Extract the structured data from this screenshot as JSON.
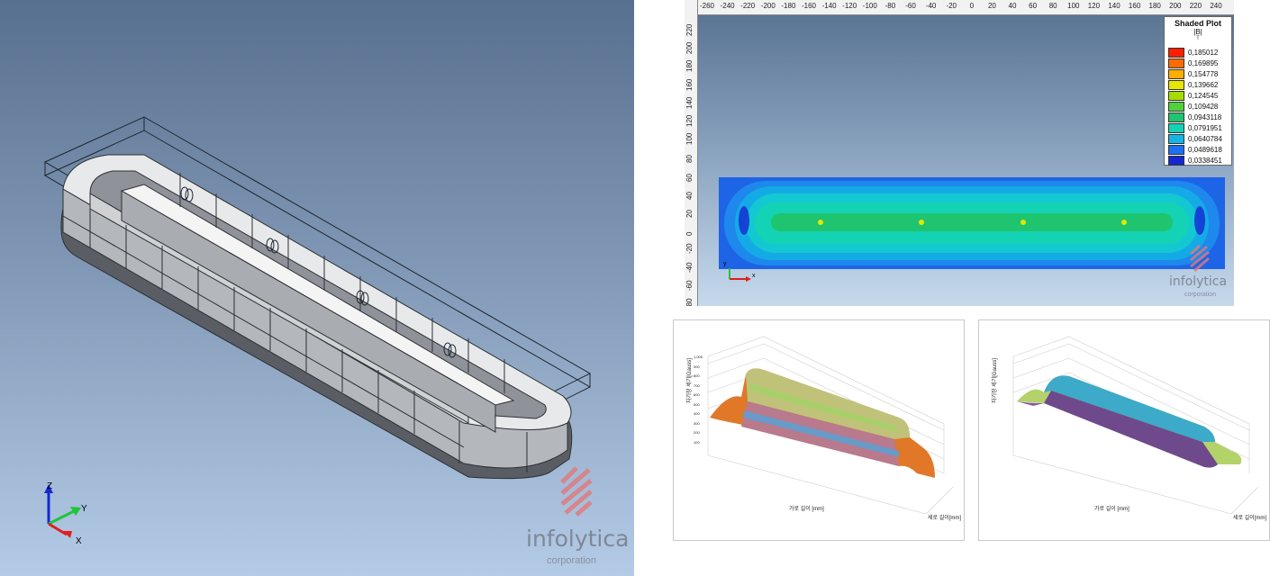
{
  "model_view": {
    "axis_labels": {
      "z": "Z",
      "y": "Y",
      "x": "X"
    },
    "logo": {
      "brand": "infolytica",
      "sub": "corporation"
    }
  },
  "plot_view": {
    "ruler_x": [
      "-260",
      "-240",
      "-220",
      "-200",
      "-180",
      "-160",
      "-140",
      "-120",
      "-100",
      "-80",
      "-60",
      "-40",
      "-20",
      "0",
      "20",
      "40",
      "60",
      "80",
      "100",
      "120",
      "140",
      "160",
      "180",
      "200",
      "220",
      "240",
      "2"
    ],
    "ruler_y": [
      "220",
      "200",
      "180",
      "160",
      "140",
      "120",
      "100",
      "80",
      "60",
      "40",
      "20",
      "0",
      "-20",
      "-40",
      "-60",
      "-80"
    ],
    "legend": {
      "title": "Shaded Plot",
      "quantity": "|B|",
      "unit": "T",
      "entries": [
        {
          "value": "0,185012",
          "color": "#ff1e00"
        },
        {
          "value": "0,169895",
          "color": "#ff6a00"
        },
        {
          "value": "0,154778",
          "color": "#ffae00"
        },
        {
          "value": "0,139662",
          "color": "#e6e600"
        },
        {
          "value": "0,124545",
          "color": "#a6dd00"
        },
        {
          "value": "0,109428",
          "color": "#4fd13a"
        },
        {
          "value": "0,0943118",
          "color": "#1fc46e"
        },
        {
          "value": "0,0791951",
          "color": "#14d2b4"
        },
        {
          "value": "0,0640784",
          "color": "#14b4e6"
        },
        {
          "value": "0,0489618",
          "color": "#1e6ef0"
        },
        {
          "value": "0,0338451",
          "color": "#1428d2"
        }
      ]
    },
    "axis_labels": {
      "y": "y",
      "x": "x"
    },
    "logo": {
      "brand": "infolytica",
      "sub": "corporation"
    }
  },
  "chart_left": {
    "z_axis_label": "자기장 세기[Gauss]",
    "x_axis_label": "가로 길이 [mm]",
    "y_axis_label": "세로 길이[mm]",
    "z_ticks": [
      "1,000",
      "900",
      "800",
      "700",
      "600",
      "500",
      "400",
      "300",
      "200",
      "100"
    ]
  },
  "chart_right": {
    "z_axis_label": "자기장 세기[Gauss]",
    "x_axis_label": "가로 길이 [mm]",
    "y_axis_label": "세로 길이[mm]",
    "z_ticks": [
      "",
      "",
      "",
      "",
      "",
      "",
      "",
      "",
      "",
      ""
    ]
  }
}
